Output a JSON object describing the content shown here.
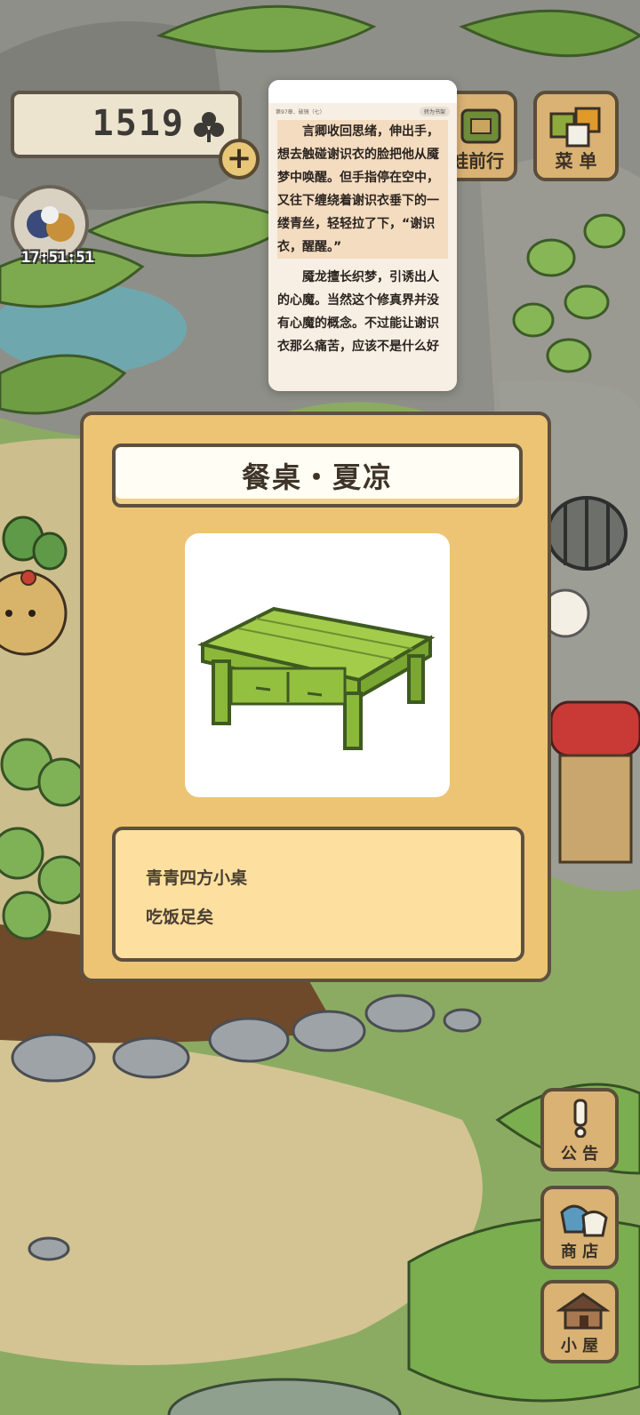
{
  "hud": {
    "clover_count": "1519",
    "clock": "17:51:51"
  },
  "top_buttons": {
    "trip_label": "蛙前行",
    "menu_label": "菜 单"
  },
  "reader": {
    "chapter": "第97章．破镜（七）",
    "chip": "转为书架",
    "paragraphs": [
      "言卿收回思绪，伸出手，想去触碰谢识衣的脸把他从魇梦中唤醒。但手指停在空中，又往下缠绕着谢识衣垂下的一缕青丝，轻轻拉了下，“谢识衣，醒醒。”",
      "魇龙擅长织梦，引诱出人的心魔。当然这个修真界并没有心魔的概念。不过能让谢识衣那么痛苦，应该不是什么好"
    ]
  },
  "item_card": {
    "title": "餐桌・夏凉",
    "description_lines": [
      "青青四方小桌",
      "吃饭足矣"
    ]
  },
  "side_buttons": {
    "notice": "公 告",
    "shop": "商 店",
    "house": "小 屋"
  }
}
